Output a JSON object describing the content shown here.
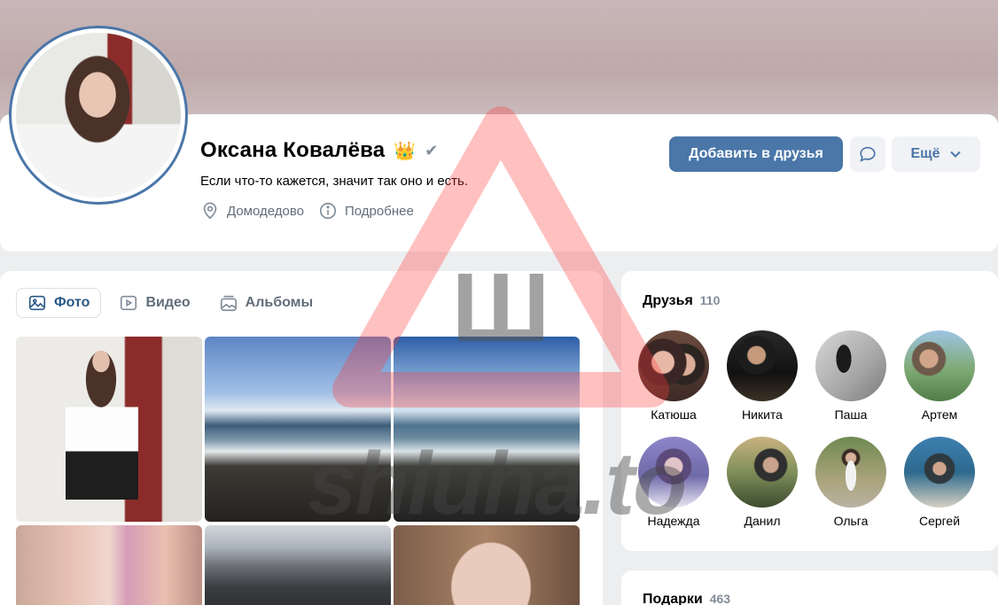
{
  "profile": {
    "name": "Оксана Ковалёва",
    "crown_icon": "👑",
    "verified_icon": "✔",
    "status": "Если что-то кажется, значит так оно и есть.",
    "city": "Домодедово",
    "details_link": "Подробнее"
  },
  "actions": {
    "add_friend": "Добавить в друзья",
    "more": "Ещё"
  },
  "media_tabs": [
    {
      "label": "Фото",
      "icon": "image-icon"
    },
    {
      "label": "Видео",
      "icon": "video-icon"
    },
    {
      "label": "Альбомы",
      "icon": "albums-icon"
    }
  ],
  "friends": {
    "title": "Друзья",
    "count": "110",
    "items": [
      {
        "name": "Катюша"
      },
      {
        "name": "Никита"
      },
      {
        "name": "Паша"
      },
      {
        "name": "Артем"
      },
      {
        "name": "Надежда"
      },
      {
        "name": "Данил"
      },
      {
        "name": "Ольга"
      },
      {
        "name": "Сергей"
      }
    ]
  },
  "gifts": {
    "title": "Подарки",
    "count": "463"
  },
  "watermark": {
    "letter": "Ш",
    "text": "shluha.to"
  },
  "colors": {
    "accent": "#4a76a8",
    "link": "#2a5885",
    "muted": "#626d7a",
    "watermark_red": "#ff3b3b"
  }
}
